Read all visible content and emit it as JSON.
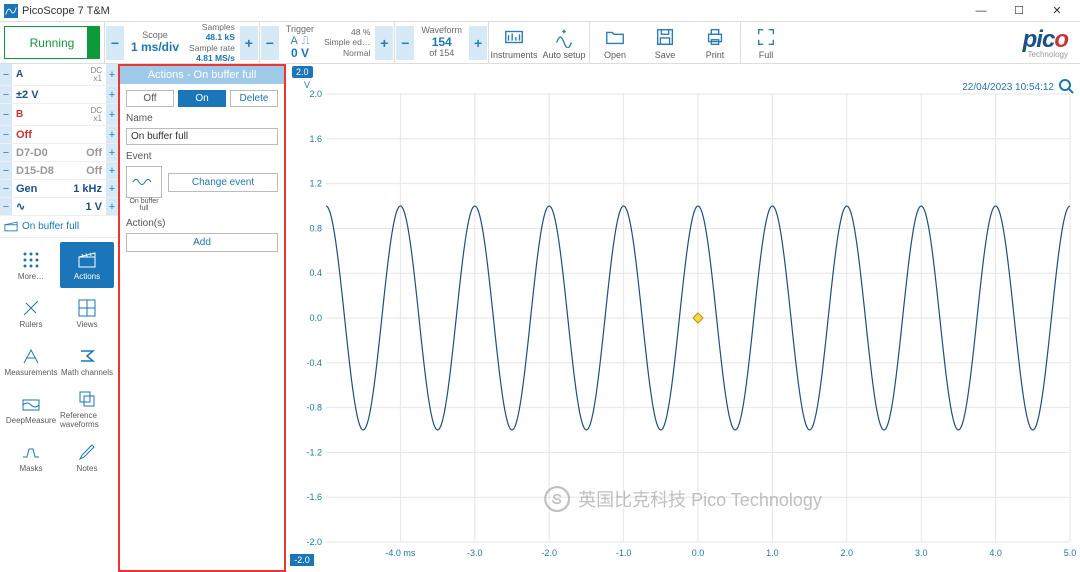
{
  "titlebar": {
    "title": "PicoScope 7 T&M"
  },
  "toolbar": {
    "running": "Running",
    "scope": {
      "lbl": "Scope",
      "val": "1 ms/div"
    },
    "samples": {
      "l1": "Samples",
      "v1": "48.1 kS",
      "l2": "Sample rate",
      "v2": "4.81 MS/s"
    },
    "trigger": {
      "lbl": "Trigger",
      "val": "0 V",
      "pct": "48 %",
      "mode": "Simple ed…",
      "norm": "Normal"
    },
    "waveform": {
      "lbl": "Waveform",
      "val": "154",
      "of": "of 154"
    },
    "buttons": {
      "instruments": "Instruments",
      "auto": "Auto setup",
      "open": "Open",
      "save": "Save",
      "print": "Print",
      "full": "Full"
    }
  },
  "channels": {
    "a": {
      "name": "A",
      "dc": "DC",
      "x": "x1",
      "val": "±2 V"
    },
    "b": {
      "name": "B",
      "dc": "DC",
      "x": "x1",
      "val": "Off"
    },
    "d1": {
      "name": "D7-D0",
      "val": "Off"
    },
    "d2": {
      "name": "D15-D8",
      "val": "Off"
    },
    "gen": {
      "name": "Gen",
      "freq": "1 kHz",
      "volt": "1 V"
    },
    "buf": "On buffer full"
  },
  "tools": {
    "more": "More…",
    "actions": "Actions",
    "rulers": "Rulers",
    "views": "Views",
    "meas": "Measurements",
    "math": "Math channels",
    "deep": "DeepMeasure",
    "ref": "Reference waveforms",
    "masks": "Masks",
    "notes": "Notes"
  },
  "panel": {
    "title": "Actions - On buffer full",
    "off": "Off",
    "on": "On",
    "delete": "Delete",
    "name_lbl": "Name",
    "name_val": "On buffer full",
    "event_lbl": "Event",
    "event_icon": "On buffer full",
    "change": "Change event",
    "actions_lbl": "Action(s)",
    "add": "Add"
  },
  "chart_data": {
    "type": "line",
    "title": "",
    "xlabel": "ms",
    "ylabel": "V",
    "xlim": [
      -5.0,
      5.0
    ],
    "ylim": [
      -2.0,
      2.0
    ],
    "x_ticks": [
      -4.0,
      -3.0,
      -2.0,
      -1.0,
      0.0,
      1.0,
      2.0,
      3.0,
      4.0,
      5.0
    ],
    "x_tick_labels": [
      "-4.0 ms",
      "-3.0",
      "-2.0",
      "-1.0",
      "0.0",
      "1.0",
      "2.0",
      "3.0",
      "4.0",
      "5.0"
    ],
    "y_ticks": [
      -2.0,
      -1.6,
      -1.2,
      -0.8,
      -0.4,
      0.0,
      0.4,
      0.8,
      1.2,
      1.6,
      2.0
    ],
    "series": [
      {
        "name": "A",
        "color": "#1a4f8b",
        "amplitude": 1.0,
        "frequency_hz": 1000,
        "phase_deg": 90
      }
    ],
    "trigger_marker": {
      "x": 0.0,
      "y": 0.0
    },
    "timestamp": "22/04/2023 10:54:12",
    "y_badge": "2.0",
    "y_unit": "V"
  },
  "watermark": "英国比克科技 Pico Technology"
}
